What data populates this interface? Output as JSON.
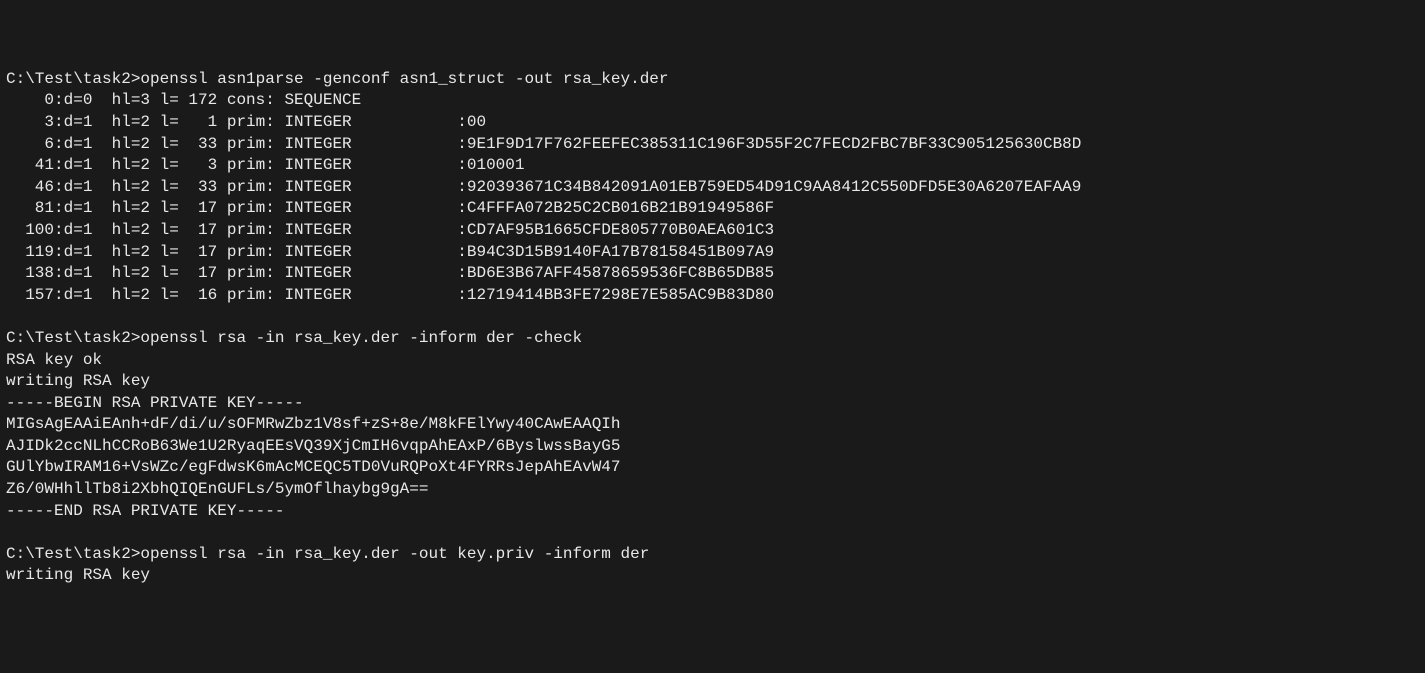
{
  "prompt": "C:\\Test\\task2>",
  "cmd1": "openssl asn1parse -genconf asn1_struct -out rsa_key.der",
  "asn1": [
    "    0:d=0  hl=3 l= 172 cons: SEQUENCE",
    "    3:d=1  hl=2 l=   1 prim: INTEGER           :00",
    "    6:d=1  hl=2 l=  33 prim: INTEGER           :9E1F9D17F762FEEFEC385311C196F3D55F2C7FECD2FBC7BF33C905125630CB8D",
    "   41:d=1  hl=2 l=   3 prim: INTEGER           :010001",
    "   46:d=1  hl=2 l=  33 prim: INTEGER           :920393671C34B842091A01EB759ED54D91C9AA8412C550DFD5E30A6207EAFAA9",
    "   81:d=1  hl=2 l=  17 prim: INTEGER           :C4FFFA072B25C2CB016B21B91949586F",
    "  100:d=1  hl=2 l=  17 prim: INTEGER           :CD7AF95B1665CFDE805770B0AEA601C3",
    "  119:d=1  hl=2 l=  17 prim: INTEGER           :B94C3D15B9140FA17B78158451B097A9",
    "  138:d=1  hl=2 l=  17 prim: INTEGER           :BD6E3B67AFF45878659536FC8B65DB85",
    "  157:d=1  hl=2 l=  16 prim: INTEGER           :12719414BB3FE7298E7E585AC9B83D80"
  ],
  "cmd2": "openssl rsa -in rsa_key.der -inform der -check",
  "check_output": [
    "RSA key ok",
    "writing RSA key",
    "-----BEGIN RSA PRIVATE KEY-----",
    "MIGsAgEAAiEAnh+dF/di/u/sOFMRwZbz1V8sf+zS+8e/M8kFElYwy40CAwEAAQIh",
    "AJIDk2ccNLhCCRoB63We1U2RyaqEEsVQ39XjCmIH6vqpAhEAxP/6ByslwssBayG5",
    "GUlYbwIRAM16+VsWZc/egFdwsK6mAcMCEQC5TD0VuRQPoXt4FYRRsJepAhEAvW47",
    "Z6/0WHhllTb8i2XbhQIQEnGUFLs/5ymOflhaybg9gA==",
    "-----END RSA PRIVATE KEY-----"
  ],
  "cmd3": "openssl rsa -in rsa_key.der -out key.priv -inform der",
  "cmd3_output": "writing RSA key"
}
